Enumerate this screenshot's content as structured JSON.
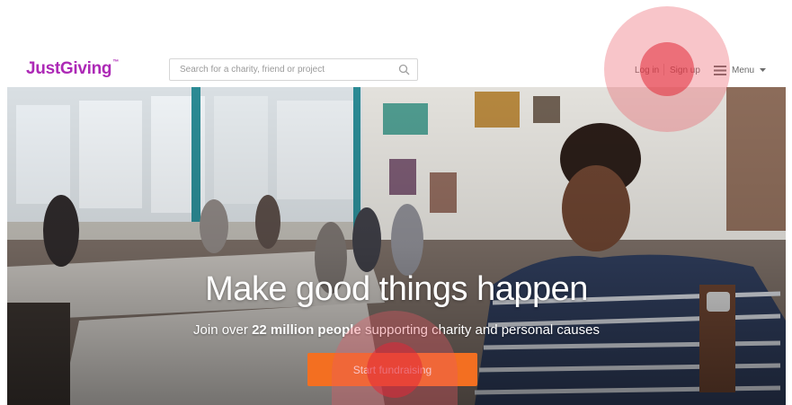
{
  "header": {
    "logo_text": "JustGiving",
    "logo_tm": "™",
    "search": {
      "placeholder": "Search for a charity, friend or project",
      "value": ""
    },
    "login_label": "Log in",
    "signup_label": "Sign up",
    "menu_label": "Menu"
  },
  "hero": {
    "title": "Make good things happen",
    "subtitle_prefix": "Join over ",
    "subtitle_bold": "22 million people",
    "subtitle_suffix": " supporting charity and personal causes",
    "cta_label": "Start fundraising"
  },
  "colors": {
    "brand": "#ad29b6",
    "cta": "#f36f21",
    "click_indicator": "#e12837"
  },
  "icons": [
    "search-icon",
    "hamburger-icon",
    "chevron-down-icon"
  ]
}
